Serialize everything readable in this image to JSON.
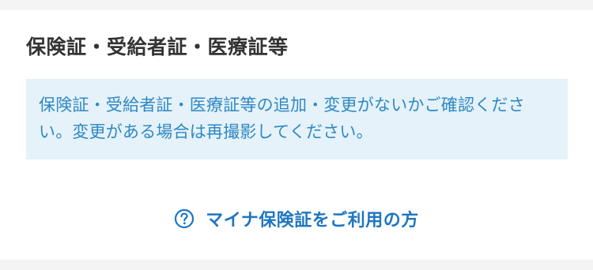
{
  "section": {
    "title": "保険証・受給者証・医療証等"
  },
  "notice": {
    "text": "保険証・受給者証・医療証等の追加・変更がないかご確認ください。変更がある場合は再撮影してください。"
  },
  "link": {
    "icon": "question-circle-icon",
    "label": "マイナ保険証をご利用の方"
  },
  "colors": {
    "title": "#333333",
    "notice_background": "#e5f2f9",
    "notice_text": "#2f88c4",
    "link": "#1f76c0"
  }
}
